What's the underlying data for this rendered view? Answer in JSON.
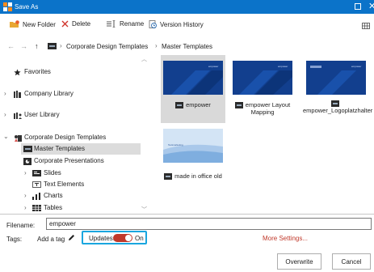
{
  "window": {
    "title": "Save As"
  },
  "toolbar": {
    "new_folder": "New Folder",
    "delete": "Delete",
    "rename": "Rename",
    "version_history": "Version History"
  },
  "address": {
    "back": "←",
    "forward": "→",
    "up": "↑",
    "crumbs": [
      "Corporate Design Templates",
      "Master Templates"
    ]
  },
  "sidebar": {
    "items": [
      {
        "label": "Favorites",
        "icon": "star-icon"
      },
      {
        "label": "Company Library",
        "icon": "library-icon"
      },
      {
        "label": "User Library",
        "icon": "user-library-icon"
      },
      {
        "label": "Corporate Design Templates",
        "icon": "templates-icon"
      },
      {
        "label": "Master Templates",
        "icon": "master-templates-icon"
      },
      {
        "label": "Corporate Presentations",
        "icon": "presentation-icon"
      },
      {
        "label": "Slides",
        "icon": "slides-icon"
      },
      {
        "label": "Text Elements",
        "icon": "text-elements-icon"
      },
      {
        "label": "Charts",
        "icon": "chart-icon"
      },
      {
        "label": "Tables",
        "icon": "table-icon"
      }
    ]
  },
  "files": [
    {
      "label": "empower",
      "thumb_text": "empower",
      "selected": true
    },
    {
      "label": "empower Layout Mapping",
      "thumb_text": "empower"
    },
    {
      "label": "empower_Logoplatzhalter",
      "thumb_text": "empower"
    },
    {
      "label": "made in office old",
      "thumb_text": "Textmarketing"
    }
  ],
  "form": {
    "filename_label": "Filename:",
    "filename_value": "empower",
    "tags_label": "Tags:",
    "add_tag": "Add a tag",
    "updates_label": "Updates:",
    "updates_state": "On",
    "more_settings": "More Settings..."
  },
  "buttons": {
    "overwrite": "Overwrite",
    "cancel": "Cancel"
  },
  "colors": {
    "title_bar": "#0b73c9",
    "accent_red": "#c0392b",
    "highlight_border": "#1aa6df"
  }
}
